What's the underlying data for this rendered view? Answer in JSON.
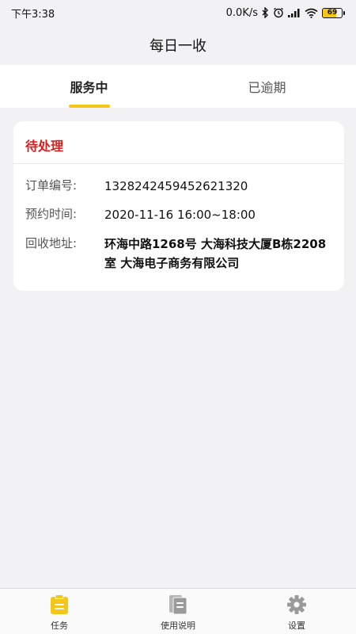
{
  "status_bar": {
    "time": "下午3:38",
    "network_speed": "0.0K/s",
    "battery_level": "69",
    "battery_fraction": 0.69
  },
  "header": {
    "title": "每日一收"
  },
  "tabs": [
    {
      "label": "服务中",
      "active": true
    },
    {
      "label": "已逾期",
      "active": false
    }
  ],
  "order": {
    "status": "待处理",
    "fields": [
      {
        "label": "订单编号:",
        "value": "1328242459452621320"
      },
      {
        "label": "预约时间:",
        "value": "2020-11-16 16:00~18:00"
      },
      {
        "label": "回收地址:",
        "value": "环海中路1268号 大海科技大厦B栋2208室 大海电子商务有限公司"
      }
    ]
  },
  "bottom_nav": [
    {
      "label": "任务",
      "icon": "clipboard-icon",
      "active": true
    },
    {
      "label": "使用说明",
      "icon": "document-icon",
      "active": false
    },
    {
      "label": "设置",
      "icon": "gear-icon",
      "active": false
    }
  ],
  "colors": {
    "accent": "#f5c518",
    "status_red": "#d81e1e",
    "inactive_icon": "#9a9a9a"
  }
}
